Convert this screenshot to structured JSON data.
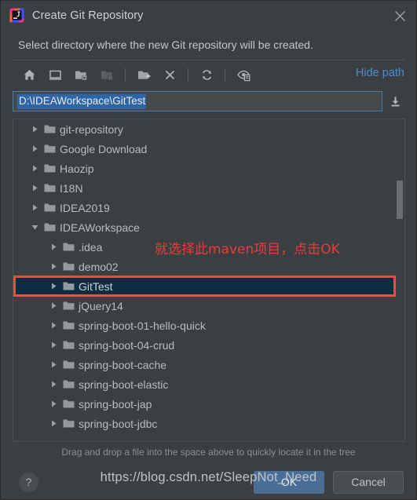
{
  "window": {
    "title": "Create Git Repository",
    "app_icon": "intellij-idea-logo",
    "close_icon": "close-icon"
  },
  "description": "Select directory where the new Git repository will be created.",
  "toolbar": {
    "hide_path_label": "Hide path",
    "buttons": [
      {
        "name": "home-icon",
        "title": "Home",
        "disabled": false
      },
      {
        "name": "desktop-icon",
        "title": "Desktop",
        "disabled": false
      },
      {
        "name": "folder-expand-icon",
        "title": "Project Folder",
        "disabled": false
      },
      {
        "name": "folder-disabled-icon",
        "title": "Module Folder",
        "disabled": true
      },
      {
        "name": "new-folder-icon",
        "title": "New Folder",
        "disabled": false
      },
      {
        "name": "delete-icon",
        "title": "Delete",
        "disabled": false
      },
      {
        "name": "refresh-icon",
        "title": "Refresh",
        "disabled": false
      },
      {
        "name": "show-hidden-files-icon",
        "title": "Show Hidden Files and Directories",
        "disabled": false
      }
    ]
  },
  "path_field": {
    "value": "D:\\IDEAWorkspace\\GitTest",
    "placeholder": "",
    "selected": true,
    "download_icon": "download-icon"
  },
  "tree": {
    "items": [
      {
        "label": "git-repository",
        "depth": 1,
        "state": "collapsed",
        "selected": false
      },
      {
        "label": "Google Download",
        "depth": 1,
        "state": "collapsed",
        "selected": false
      },
      {
        "label": "Haozip",
        "depth": 1,
        "state": "collapsed",
        "selected": false
      },
      {
        "label": "I18N",
        "depth": 1,
        "state": "collapsed",
        "selected": false
      },
      {
        "label": "IDEA2019",
        "depth": 1,
        "state": "collapsed",
        "selected": false
      },
      {
        "label": "IDEAWorkspace",
        "depth": 1,
        "state": "expanded",
        "selected": false
      },
      {
        "label": ".idea",
        "depth": 2,
        "state": "collapsed",
        "selected": false
      },
      {
        "label": "demo02",
        "depth": 2,
        "state": "collapsed",
        "selected": false
      },
      {
        "label": "GitTest",
        "depth": 2,
        "state": "collapsed",
        "selected": true
      },
      {
        "label": "jQuery14",
        "depth": 2,
        "state": "collapsed",
        "selected": false
      },
      {
        "label": "spring-boot-01-hello-quick",
        "depth": 2,
        "state": "collapsed",
        "selected": false
      },
      {
        "label": "spring-boot-04-crud",
        "depth": 2,
        "state": "collapsed",
        "selected": false
      },
      {
        "label": "spring-boot-cache",
        "depth": 2,
        "state": "collapsed",
        "selected": false
      },
      {
        "label": "spring-boot-elastic",
        "depth": 2,
        "state": "collapsed",
        "selected": false
      },
      {
        "label": "spring-boot-jap",
        "depth": 2,
        "state": "collapsed",
        "selected": false
      },
      {
        "label": "spring-boot-jdbc",
        "depth": 2,
        "state": "collapsed",
        "selected": false
      }
    ],
    "scrollbar": {
      "thumb_top_pct": 19,
      "thumb_height_pct": 12
    }
  },
  "annotation": {
    "text": "就选择此maven项目，点击OK",
    "color": "#e83b3b"
  },
  "hint": "Drag and drop a file into the space above to quickly locate it in the tree",
  "footer": {
    "help_label": "?",
    "ok_label": "OK",
    "cancel_label": "Cancel"
  },
  "watermark": "https://blog.csdn.net/SleepNot_Need",
  "colors": {
    "dialog_bg": "#3c3f41",
    "selection_bg": "#0d2b41",
    "selection_outline": "#ff4444",
    "link": "#4c8ccc",
    "ok_button": "#4a6e96",
    "text_selection": "#2f65a8"
  }
}
